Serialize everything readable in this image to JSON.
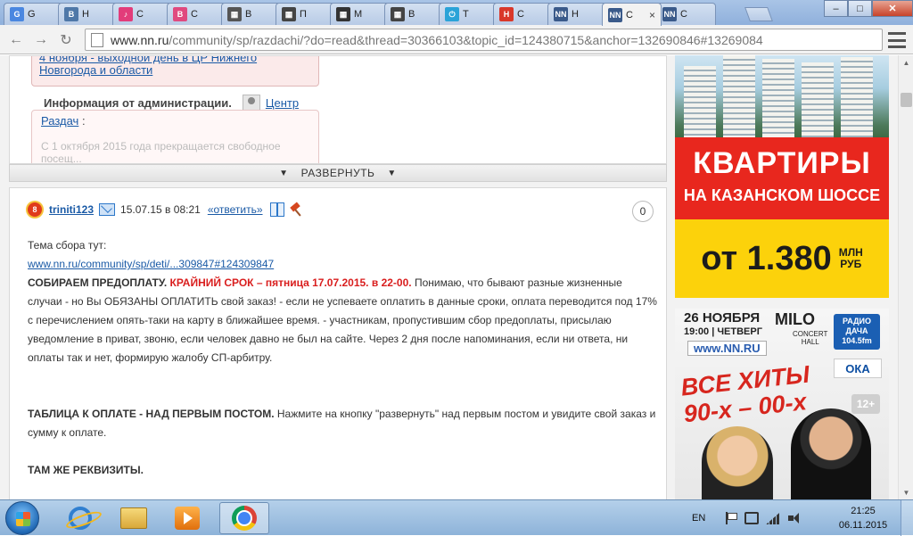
{
  "browser": {
    "tabs": [
      {
        "label": "G",
        "favicon": "G",
        "color": "#4a87e0",
        "active": false
      },
      {
        "label": "Н",
        "favicon": "В",
        "color": "#4f78a8",
        "active": false
      },
      {
        "label": "С",
        "favicon": "♪",
        "color": "#e23c7a",
        "active": false
      },
      {
        "label": "С",
        "favicon": "В",
        "color": "#e04a7f",
        "active": false
      },
      {
        "label": "В",
        "favicon": "▦",
        "color": "#555555",
        "active": false
      },
      {
        "label": "П",
        "favicon": "▦",
        "color": "#444444",
        "active": false
      },
      {
        "label": "М",
        "favicon": "▦",
        "color": "#333333",
        "active": false
      },
      {
        "label": "В",
        "favicon": "▦",
        "color": "#444444",
        "active": false
      },
      {
        "label": "Т",
        "favicon": "⏻",
        "color": "#2aa3d8",
        "active": false
      },
      {
        "label": "С",
        "favicon": "H",
        "color": "#d9382a",
        "active": false
      },
      {
        "label": "Н",
        "favicon": "NN",
        "color": "#3a5a8a",
        "active": false
      },
      {
        "label": "С",
        "favicon": "NN",
        "color": "#3a5a8a",
        "active": true
      },
      {
        "label": "С",
        "favicon": "NN",
        "color": "#3a5a8a",
        "active": false
      }
    ],
    "tab_close": "×",
    "url_host": "www.nn.ru",
    "url_path": "/community/sp/razdachi/?do=read&thread=30366103&topic_id=124380715&anchor=132690846#13269084",
    "nav": {
      "back": "←",
      "forward": "→",
      "reload": "↻"
    },
    "window_controls": {
      "minimize": "–",
      "maximize": "□",
      "close": "✕"
    }
  },
  "admin": {
    "alert_text": "4 ноября - выходной день в ЦР Нижнего Новгорода и области",
    "header_label": "Информация от администрации.",
    "center_link": "Центр",
    "card_title": "Раздач",
    "card_colon": ":",
    "card_faded": "С 1 октября 2015 года прекращается свободное посещ..."
  },
  "expand": {
    "label": "РАЗВЕРНУТЬ",
    "arrow": "▼"
  },
  "post": {
    "username": "triniti123",
    "badge": "8",
    "datetime": "15.07.15 в 08:21",
    "reply_link": "«ответить»",
    "reply_count": "0",
    "topic_label": "Тема сбора тут:",
    "topic_link": "www.nn.ru/community/sp/deti/...309847#124309847",
    "prepay_bold": "СОБИРАЕМ ПРЕДОПЛАТУ.",
    "deadline_red": "КРАЙНИЙ СРОК – пятница 17.07.2015. в 22-00.",
    "prepay_text": "Понимаю, что бывают разные жизненные случаи - но Вы ОБЯЗАНЫ ОПЛАТИТЬ свой заказ! - если не успеваете оплатить в данные сроки, оплата переводится под 17% с перечислением опять-таки на карту в ближайшее время. - участникам, пропустившим сбор предоплаты, присылаю уведомление в приват, звоню, если человек давно не был на сайте. Через 2 дня после напоминания, если ни ответа, ни оплаты так и нет, формирую жалобу СП-арбитру.",
    "table_bold": "ТАБЛИЦА К ОПЛАТЕ - НАД ПЕРВЫМ ПОСТОМ.",
    "table_text": "Нажмите на кнопку \"развернуть\" над первым постом и увидите свой заказ и сумму к оплате.",
    "requisites_bold": "ТАМ ЖЕ РЕКВИЗИТЫ."
  },
  "ad1": {
    "headline": "КВАРТИРЫ",
    "subline": "НА КАЗАНСКОМ ШОССЕ",
    "price": "от 1.380",
    "unit_top": "МЛН",
    "unit_bottom": "РУБ"
  },
  "ad2": {
    "date": "26 НОЯБРЯ",
    "time": "19:00 | ЧЕТВЕРГ",
    "venue": "MILO",
    "venue_sub1": "CONCERT",
    "venue_sub2": "HALL",
    "radio": "РАДИО ДАЧА 104.5fm",
    "site": "www.NN.RU",
    "sponsor": "ОКА",
    "hits_line1": "ВСЕ ХИТЫ",
    "hits_line2": "90-х – 00-х",
    "age": "12+"
  },
  "taskbar": {
    "lang": "EN",
    "time": "21:25",
    "date": "06.11.2015"
  },
  "scrollbar": {
    "up": "▲",
    "down": "▼"
  }
}
